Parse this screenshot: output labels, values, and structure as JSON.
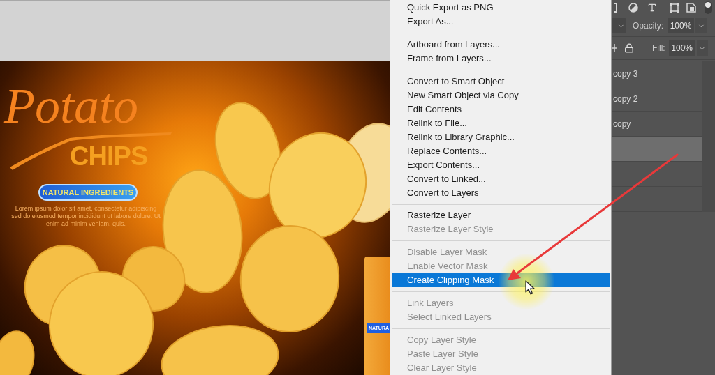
{
  "canvas": {
    "script_title": "Potato",
    "title": "CHIPS",
    "badge": "NATURAL INGREDIENTS",
    "body": "Lorem ipsum dolor sit amet, consectetur adipiscing sed do eiusmod tempor incididunt ut labore dolore. Ut enim ad minim veniam, quis.",
    "package_label": "NATURA"
  },
  "context_menu": {
    "sections": [
      {
        "items": [
          {
            "label": "Quick Export as PNG",
            "disabled": false,
            "selected": false
          },
          {
            "label": "Export As...",
            "disabled": false,
            "selected": false
          }
        ]
      },
      {
        "items": [
          {
            "label": "Artboard from Layers...",
            "disabled": false,
            "selected": false
          },
          {
            "label": "Frame from Layers...",
            "disabled": false,
            "selected": false
          }
        ]
      },
      {
        "items": [
          {
            "label": "Convert to Smart Object",
            "disabled": false,
            "selected": false
          },
          {
            "label": "New Smart Object via Copy",
            "disabled": false,
            "selected": false
          },
          {
            "label": "Edit Contents",
            "disabled": false,
            "selected": false
          },
          {
            "label": "Relink to File...",
            "disabled": false,
            "selected": false
          },
          {
            "label": "Relink to Library Graphic...",
            "disabled": false,
            "selected": false
          },
          {
            "label": "Replace Contents...",
            "disabled": false,
            "selected": false
          },
          {
            "label": "Export Contents...",
            "disabled": false,
            "selected": false
          },
          {
            "label": "Convert to Linked...",
            "disabled": false,
            "selected": false
          },
          {
            "label": "Convert to Layers",
            "disabled": false,
            "selected": false
          }
        ]
      },
      {
        "items": [
          {
            "label": "Rasterize Layer",
            "disabled": false,
            "selected": false
          },
          {
            "label": "Rasterize Layer Style",
            "disabled": true,
            "selected": false
          }
        ]
      },
      {
        "items": [
          {
            "label": "Disable Layer Mask",
            "disabled": true,
            "selected": false
          },
          {
            "label": "Enable Vector Mask",
            "disabled": true,
            "selected": false
          },
          {
            "label": "Create Clipping Mask",
            "disabled": false,
            "selected": true
          }
        ]
      },
      {
        "items": [
          {
            "label": "Link Layers",
            "disabled": true,
            "selected": false
          },
          {
            "label": "Select Linked Layers",
            "disabled": true,
            "selected": false
          }
        ]
      },
      {
        "items": [
          {
            "label": "Copy Layer Style",
            "disabled": true,
            "selected": false
          },
          {
            "label": "Paste Layer Style",
            "disabled": true,
            "selected": false
          },
          {
            "label": "Clear Layer Style",
            "disabled": true,
            "selected": false
          }
        ]
      }
    ]
  },
  "layers_panel": {
    "opacity_label": "Opacity:",
    "opacity_value": "100%",
    "fill_label": "Fill:",
    "fill_value": "100%",
    "layers": [
      {
        "name": "copy 3",
        "selected": false
      },
      {
        "name": "copy 2",
        "selected": false
      },
      {
        "name": "copy",
        "selected": false
      },
      {
        "selected": true
      },
      {
        "selected": false
      },
      {
        "selected": false
      }
    ]
  }
}
